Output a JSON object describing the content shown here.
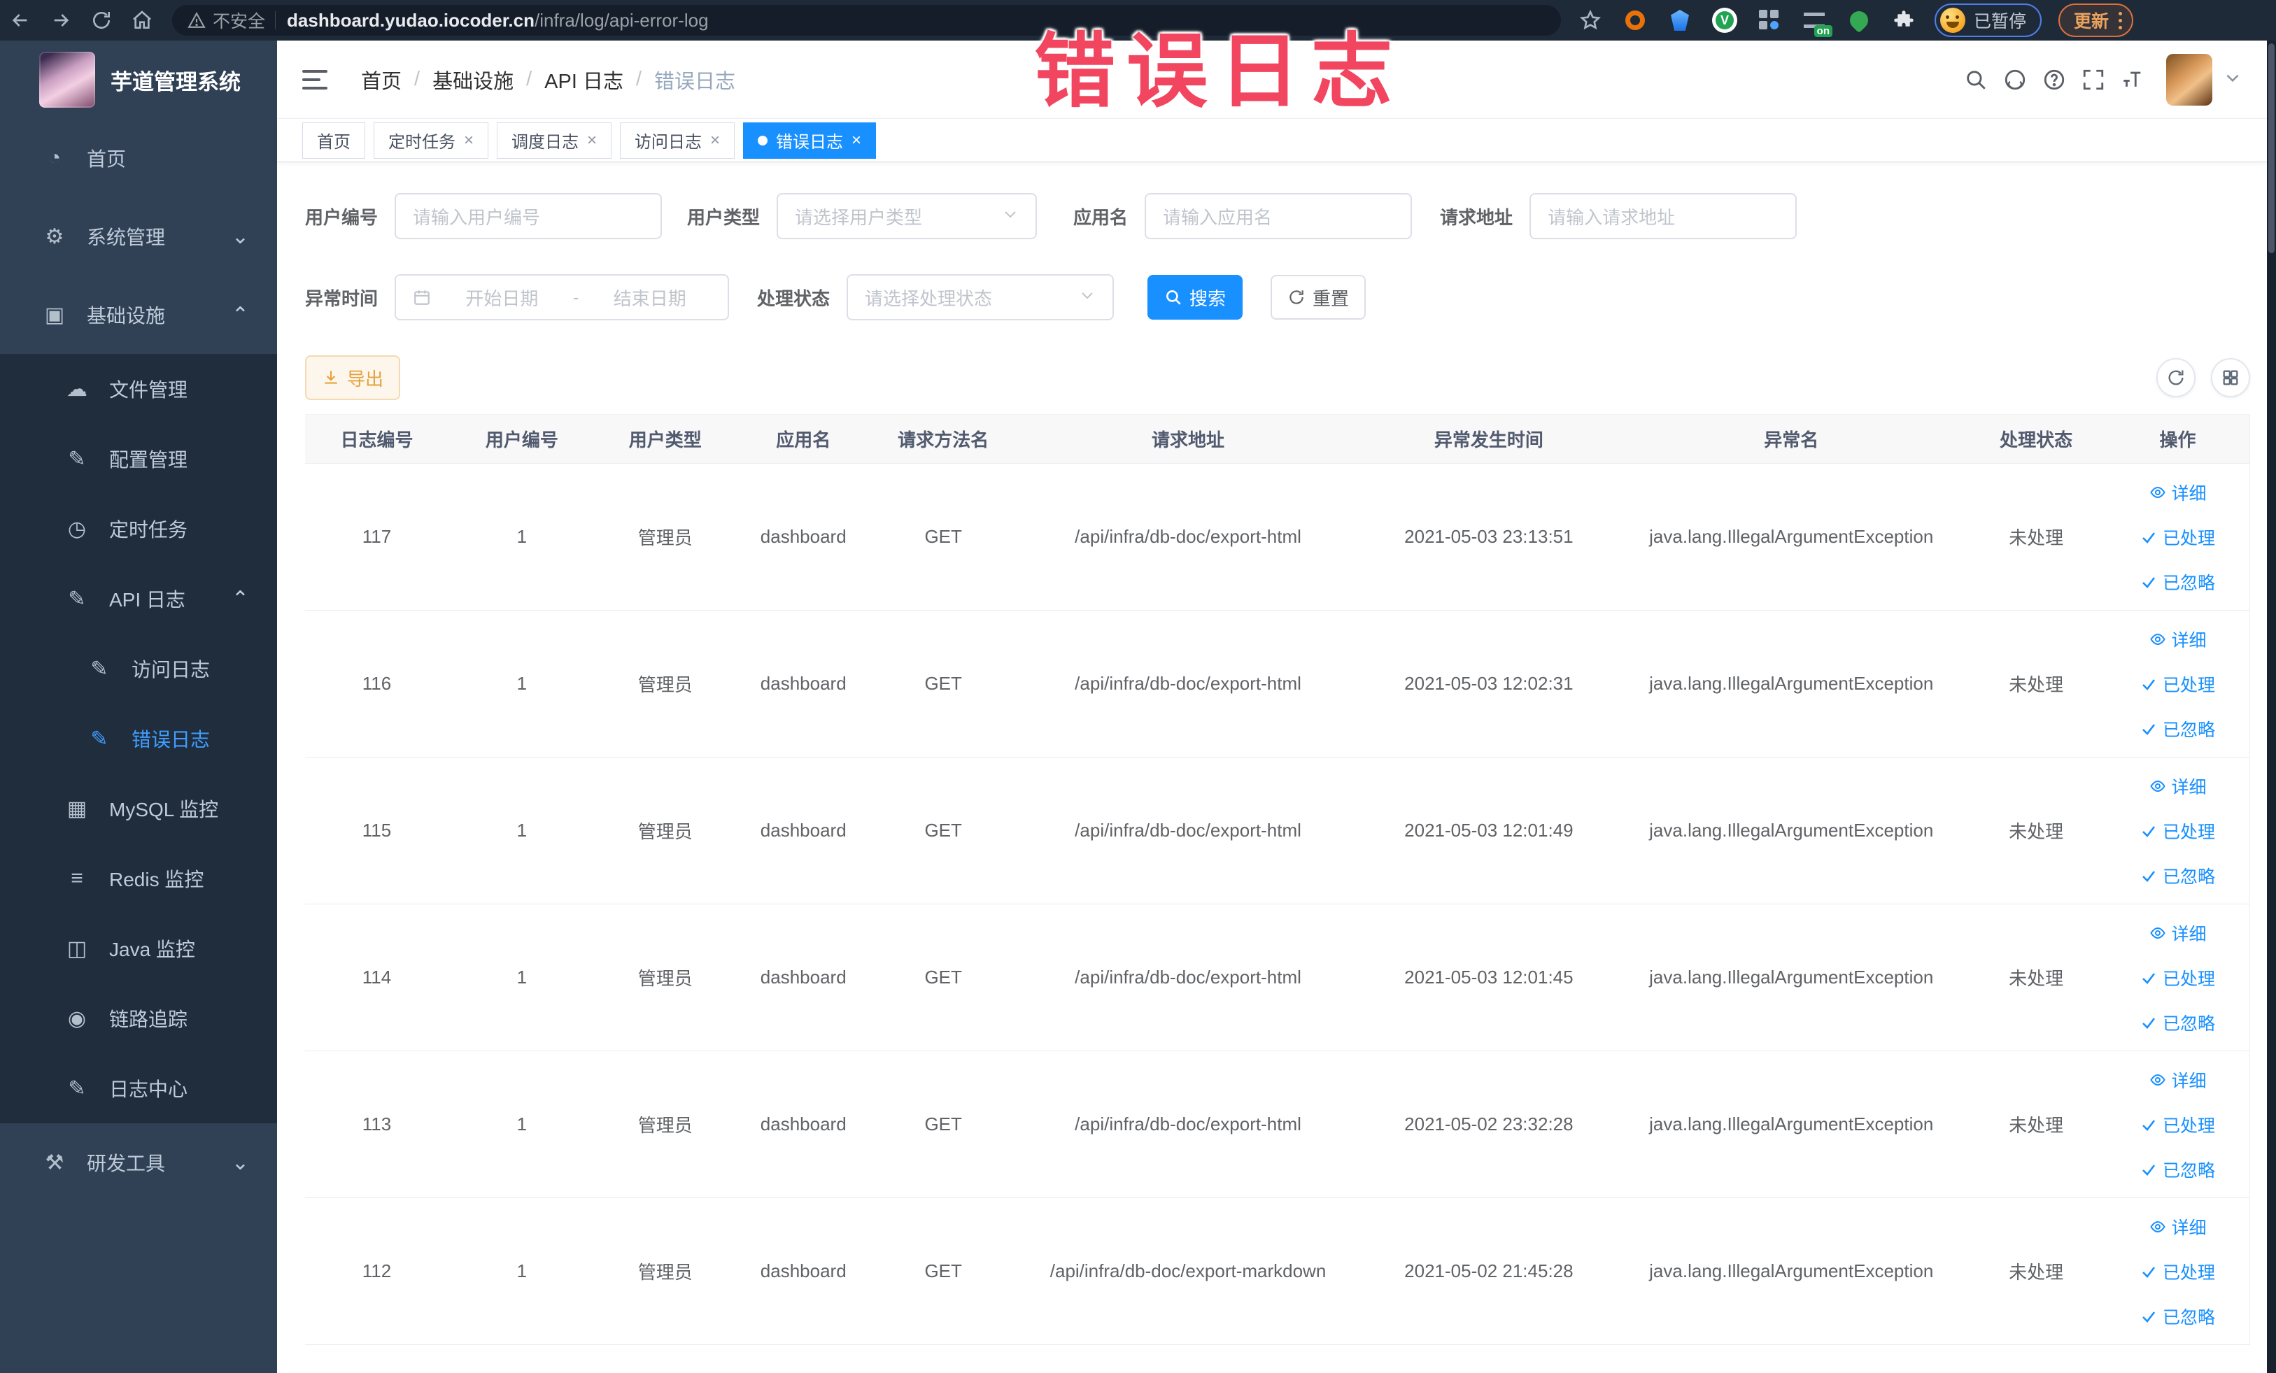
{
  "watermark": {
    "text": "错误日志",
    "color": "#f2455f"
  },
  "browser": {
    "security_label": "不安全",
    "url_host": "dashboard.yudao.iocoder.cn",
    "url_path": "/infra/log/api-error-log",
    "extension_badge": "on",
    "profile_chip_label": "已暂停",
    "update_button_label": "更新",
    "icons": [
      "back-icon",
      "forward-icon",
      "reload-icon",
      "home-icon",
      "warning-icon",
      "bookmark-star-icon",
      "extensions-puzzle-icon",
      "kebab-menu-icon"
    ]
  },
  "sidebar": {
    "title": "芋道管理系统",
    "items": [
      {
        "label": "首页",
        "level": 1,
        "icon": "gauge",
        "sub": false,
        "active": false,
        "chevron": null
      },
      {
        "label": "系统管理",
        "level": 1,
        "icon": "gear",
        "sub": false,
        "active": false,
        "chevron": "down"
      },
      {
        "label": "基础设施",
        "level": 1,
        "icon": "monitor",
        "sub": false,
        "active": false,
        "chevron": "up"
      },
      {
        "label": "文件管理",
        "level": 2,
        "icon": "cloud",
        "sub": true,
        "active": false,
        "chevron": null
      },
      {
        "label": "配置管理",
        "level": 2,
        "icon": "edit",
        "sub": true,
        "active": false,
        "chevron": null
      },
      {
        "label": "定时任务",
        "level": 2,
        "icon": "timer",
        "sub": true,
        "active": false,
        "chevron": null
      },
      {
        "label": "API 日志",
        "level": 2,
        "icon": "log",
        "sub": true,
        "active": false,
        "chevron": "up"
      },
      {
        "label": "访问日志",
        "level": 3,
        "icon": "log",
        "sub": true,
        "active": false,
        "chevron": null
      },
      {
        "label": "错误日志",
        "level": 3,
        "icon": "log",
        "sub": true,
        "active": true,
        "chevron": null
      },
      {
        "label": "MySQL 监控",
        "level": 2,
        "icon": "chart",
        "sub": true,
        "active": false,
        "chevron": null
      },
      {
        "label": "Redis 监控",
        "level": 2,
        "icon": "layers",
        "sub": true,
        "active": false,
        "chevron": null
      },
      {
        "label": "Java 监控",
        "level": 2,
        "icon": "java",
        "sub": true,
        "active": false,
        "chevron": null
      },
      {
        "label": "链路追踪",
        "level": 2,
        "icon": "eye",
        "sub": true,
        "active": false,
        "chevron": null
      },
      {
        "label": "日志中心",
        "level": 2,
        "icon": "log",
        "sub": true,
        "active": false,
        "chevron": null
      },
      {
        "label": "研发工具",
        "level": 1,
        "icon": "tools",
        "sub": false,
        "active": false,
        "chevron": "down"
      }
    ]
  },
  "icon_glyphs": {
    "gauge": "◔",
    "gear": "⚙",
    "monitor": "▣",
    "cloud": "☁",
    "edit": "✎",
    "timer": "◷",
    "log": "✎",
    "chart": "▦",
    "layers": "≡",
    "java": "◫",
    "eye": "◉",
    "tools": "⚒",
    "chevron_up": "⌃",
    "chevron_down": "⌄"
  },
  "navbar": {
    "breadcrumb": [
      "首页",
      "基础设施",
      "API 日志",
      "错误日志"
    ],
    "separator": "/",
    "icons": [
      "search-icon",
      "github-icon",
      "help-icon",
      "fullscreen-icon",
      "font-size-icon",
      "avatar",
      "chevron-down-icon"
    ]
  },
  "tabs": [
    {
      "label": "首页",
      "active": false,
      "closable": false
    },
    {
      "label": "定时任务",
      "active": false,
      "closable": true
    },
    {
      "label": "调度日志",
      "active": false,
      "closable": true
    },
    {
      "label": "访问日志",
      "active": false,
      "closable": true
    },
    {
      "label": "错误日志",
      "active": true,
      "closable": true
    }
  ],
  "tab_close_glyph": "×",
  "filters": {
    "user_id": {
      "label": "用户编号",
      "placeholder": "请输入用户编号"
    },
    "user_type": {
      "label": "用户类型",
      "placeholder": "请选择用户类型"
    },
    "app_name": {
      "label": "应用名",
      "placeholder": "请输入应用名"
    },
    "request_url": {
      "label": "请求地址",
      "placeholder": "请输入请求地址"
    },
    "exception_time": {
      "label": "异常时间",
      "start_placeholder": "开始日期",
      "separator": "-",
      "end_placeholder": "结束日期"
    },
    "process_status": {
      "label": "处理状态",
      "placeholder": "请选择处理状态"
    },
    "search_button": "搜索",
    "reset_button": "重置"
  },
  "toolbar": {
    "export_button": "导出"
  },
  "table": {
    "columns": [
      "日志编号",
      "用户编号",
      "用户类型",
      "应用名",
      "请求方法名",
      "请求地址",
      "异常发生时间",
      "异常名",
      "处理状态",
      "操作"
    ],
    "actions": [
      {
        "label": "详细",
        "icon": "eye"
      },
      {
        "label": "已处理",
        "icon": "check"
      },
      {
        "label": "已忽略",
        "icon": "check"
      }
    ],
    "rows": [
      {
        "id": "117",
        "user_id": "1",
        "user_type": "管理员",
        "app_name": "dashboard",
        "method": "GET",
        "url": "/api/infra/db-doc/export-html",
        "time": "2021-05-03 23:13:51",
        "exception": "java.lang.IllegalArgumentException",
        "status": "未处理"
      },
      {
        "id": "116",
        "user_id": "1",
        "user_type": "管理员",
        "app_name": "dashboard",
        "method": "GET",
        "url": "/api/infra/db-doc/export-html",
        "time": "2021-05-03 12:02:31",
        "exception": "java.lang.IllegalArgumentException",
        "status": "未处理"
      },
      {
        "id": "115",
        "user_id": "1",
        "user_type": "管理员",
        "app_name": "dashboard",
        "method": "GET",
        "url": "/api/infra/db-doc/export-html",
        "time": "2021-05-03 12:01:49",
        "exception": "java.lang.IllegalArgumentException",
        "status": "未处理"
      },
      {
        "id": "114",
        "user_id": "1",
        "user_type": "管理员",
        "app_name": "dashboard",
        "method": "GET",
        "url": "/api/infra/db-doc/export-html",
        "time": "2021-05-03 12:01:45",
        "exception": "java.lang.IllegalArgumentException",
        "status": "未处理"
      },
      {
        "id": "113",
        "user_id": "1",
        "user_type": "管理员",
        "app_name": "dashboard",
        "method": "GET",
        "url": "/api/infra/db-doc/export-html",
        "time": "2021-05-02 23:32:28",
        "exception": "java.lang.IllegalArgumentException",
        "status": "未处理"
      },
      {
        "id": "112",
        "user_id": "1",
        "user_type": "管理员",
        "app_name": "dashboard",
        "method": "GET",
        "url": "/api/infra/db-doc/export-markdown",
        "time": "2021-05-02 21:45:28",
        "exception": "java.lang.IllegalArgumentException",
        "status": "未处理"
      }
    ]
  },
  "colors": {
    "theme_blue": "#1890ff",
    "sidebar_bg": "#304156",
    "submenu_bg": "#1f2d3d",
    "active_text": "#409eff",
    "warning": "#e6a23c",
    "watermark": "#f2455f"
  }
}
